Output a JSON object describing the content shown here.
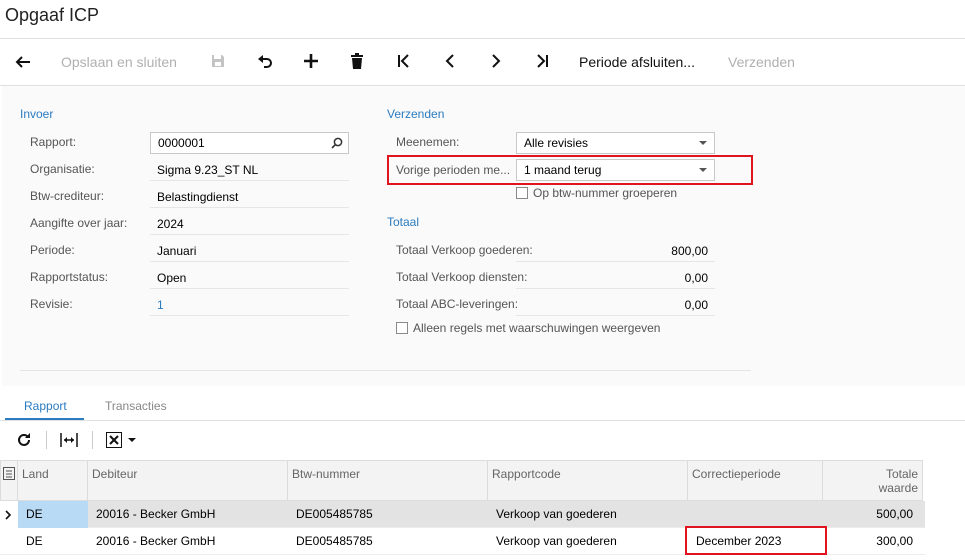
{
  "page": {
    "title": "Opgaaf ICP"
  },
  "toolbar": {
    "save_close": "Opslaan en sluiten",
    "close_period": "Periode afsluiten...",
    "send": "Verzenden"
  },
  "invoer": {
    "title": "Invoer",
    "fields": [
      {
        "label": "Rapport:",
        "value": "0000001"
      },
      {
        "label": "Organisatie:",
        "value": "Sigma 9.23_ST NL"
      },
      {
        "label": "Btw-crediteur:",
        "value": "Belastingdienst"
      },
      {
        "label": "Aangifte over jaar:",
        "value": "2024"
      },
      {
        "label": "Periode:",
        "value": "Januari"
      },
      {
        "label": "Rapportstatus:",
        "value": "Open"
      },
      {
        "label": "Revisie:",
        "value": "1"
      }
    ]
  },
  "verzenden": {
    "title": "Verzenden",
    "meenemen_label": "Meenemen:",
    "meenemen_value": "Alle revisies",
    "vorige_label": "Vorige perioden me...",
    "vorige_value": "1 maand terug",
    "group_checkbox": "Op btw-nummer groeperen"
  },
  "totaal": {
    "title": "Totaal",
    "rows": [
      {
        "label": "Totaal Verkoop goederen:",
        "value": "800,00"
      },
      {
        "label": "Totaal Verkoop diensten:",
        "value": "0,00"
      },
      {
        "label": "Totaal ABC-leveringen:",
        "value": "0,00"
      }
    ],
    "warnings_checkbox": "Alleen regels met waarschuwingen weergeven"
  },
  "tabs": [
    {
      "label": "Rapport",
      "active": true
    },
    {
      "label": "Transacties",
      "active": false
    }
  ],
  "grid": {
    "columns": [
      "Land",
      "Debiteur",
      "Btw-nummer",
      "Rapportcode",
      "Correctieperiode",
      "Totale waarde"
    ],
    "rows": [
      {
        "land": "DE",
        "debiteur": "20016 - Becker GmbH",
        "btw": "DE005485785",
        "code": "Verkoop van goederen",
        "correctie": "",
        "totaal": "500,00"
      },
      {
        "land": "DE",
        "debiteur": "20016 - Becker GmbH",
        "btw": "DE005485785",
        "code": "Verkoop van goederen",
        "correctie": "December 2023",
        "totaal": "300,00"
      }
    ]
  },
  "colors": {
    "accent": "#2a7bc0",
    "highlight": "#e0141e",
    "selected_row": "#e3e3e3",
    "selected_cell": "#b8daf4"
  }
}
